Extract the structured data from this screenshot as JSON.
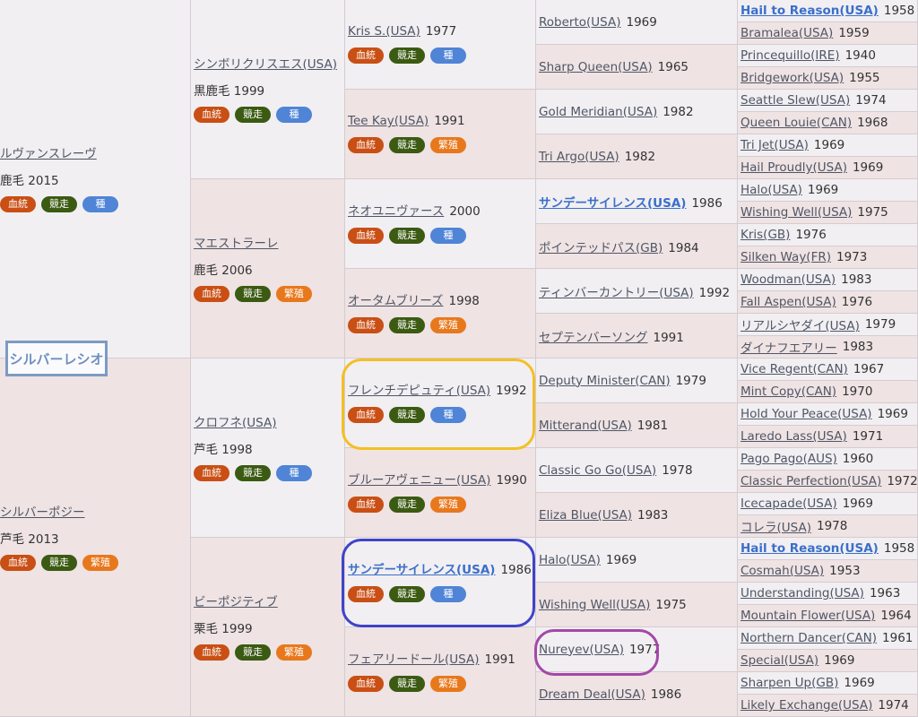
{
  "badges": {
    "red": "血統",
    "green": "競走",
    "blue": "種",
    "orange": "繁殖"
  },
  "subject": "シルバーレシオ",
  "gen1": [
    {
      "name": "ルヴァンスレーヴ",
      "coat": "鹿毛 2015",
      "tags": [
        "red",
        "green",
        "blue"
      ]
    },
    {
      "name": "シルバーポジー",
      "coat": "芦毛 2013",
      "tags": [
        "red",
        "green",
        "orange"
      ]
    }
  ],
  "gen2": [
    {
      "name": "シンボリクリスエス(USA)",
      "coat": "黒鹿毛 1999",
      "tags": [
        "red",
        "green",
        "blue"
      ]
    },
    {
      "name": "マエストラーレ",
      "coat": "鹿毛 2006",
      "tags": [
        "red",
        "green",
        "orange"
      ]
    },
    {
      "name": "クロフネ(USA)",
      "coat": "芦毛 1998",
      "tags": [
        "red",
        "green",
        "blue"
      ]
    },
    {
      "name": "ビーポジティブ",
      "coat": "栗毛 1999",
      "tags": [
        "red",
        "green",
        "orange"
      ]
    }
  ],
  "gen3": [
    {
      "name": "Kris S.(USA)",
      "year": "1977",
      "tags": [
        "red",
        "green",
        "blue"
      ]
    },
    {
      "name": "Tee Kay(USA)",
      "year": "1991",
      "tags": [
        "red",
        "green",
        "orange"
      ]
    },
    {
      "name": "ネオユニヴァース",
      "year": "2000",
      "tags": [
        "red",
        "green",
        "blue"
      ]
    },
    {
      "name": "オータムブリーズ",
      "year": "1998",
      "tags": [
        "red",
        "green",
        "orange"
      ]
    },
    {
      "name": "フレンチデピュティ(USA)",
      "year": "1992",
      "tags": [
        "red",
        "green",
        "blue"
      ]
    },
    {
      "name": "ブルーアヴェニュー(USA)",
      "year": "1990",
      "tags": [
        "red",
        "green",
        "orange"
      ]
    },
    {
      "name": "サンデーサイレンス(USA)",
      "year": "1986",
      "tags": [
        "red",
        "green",
        "blue"
      ],
      "bold": true
    },
    {
      "name": "フェアリードール(USA)",
      "year": "1991",
      "tags": [
        "red",
        "green",
        "orange"
      ]
    }
  ],
  "gen4": [
    {
      "name": "Roberto(USA)",
      "year": "1969"
    },
    {
      "name": "Sharp Queen(USA)",
      "year": "1965"
    },
    {
      "name": "Gold Meridian(USA)",
      "year": "1982"
    },
    {
      "name": "Tri Argo(USA)",
      "year": "1982"
    },
    {
      "name": "サンデーサイレンス(USA)",
      "year": "1986",
      "bold": true
    },
    {
      "name": "ポインテッドパス(GB)",
      "year": "1984"
    },
    {
      "name": "ティンバーカントリー(USA)",
      "year": "1992"
    },
    {
      "name": "セプテンバーソング",
      "year": "1991"
    },
    {
      "name": "Deputy Minister(CAN)",
      "year": "1979"
    },
    {
      "name": "Mitterand(USA)",
      "year": "1981"
    },
    {
      "name": "Classic Go Go(USA)",
      "year": "1978"
    },
    {
      "name": "Eliza Blue(USA)",
      "year": "1983"
    },
    {
      "name": "Halo(USA)",
      "year": "1969"
    },
    {
      "name": "Wishing Well(USA)",
      "year": "1975"
    },
    {
      "name": "Nureyev(USA)",
      "year": "1977"
    },
    {
      "name": "Dream Deal(USA)",
      "year": "1986"
    }
  ],
  "gen5": [
    {
      "name": "Hail to Reason(USA)",
      "year": "1958",
      "bold": true
    },
    {
      "name": "Bramalea(USA)",
      "year": "1959"
    },
    {
      "name": "Princequillo(IRE)",
      "year": "1940"
    },
    {
      "name": "Bridgework(USA)",
      "year": "1955"
    },
    {
      "name": "Seattle Slew(USA)",
      "year": "1974"
    },
    {
      "name": "Queen Louie(CAN)",
      "year": "1968"
    },
    {
      "name": "Tri Jet(USA)",
      "year": "1969"
    },
    {
      "name": "Hail Proudly(USA)",
      "year": "1969"
    },
    {
      "name": "Halo(USA)",
      "year": "1969"
    },
    {
      "name": "Wishing Well(USA)",
      "year": "1975"
    },
    {
      "name": "Kris(GB)",
      "year": "1976"
    },
    {
      "name": "Silken Way(FR)",
      "year": "1973"
    },
    {
      "name": "Woodman(USA)",
      "year": "1983"
    },
    {
      "name": "Fall Aspen(USA)",
      "year": "1976"
    },
    {
      "name": "リアルシヤダイ(USA)",
      "year": "1979"
    },
    {
      "name": "ダイナフエアリー",
      "year": "1983"
    },
    {
      "name": "Vice Regent(CAN)",
      "year": "1967"
    },
    {
      "name": "Mint Copy(CAN)",
      "year": "1970"
    },
    {
      "name": "Hold Your Peace(USA)",
      "year": "1969"
    },
    {
      "name": "Laredo Lass(USA)",
      "year": "1971"
    },
    {
      "name": "Pago Pago(AUS)",
      "year": "1960"
    },
    {
      "name": "Classic Perfection(USA)",
      "year": "1972"
    },
    {
      "name": "Icecapade(USA)",
      "year": "1969"
    },
    {
      "name": "コレラ(USA)",
      "year": "1978"
    },
    {
      "name": "Hail to Reason(USA)",
      "year": "1958",
      "bold": true
    },
    {
      "name": "Cosmah(USA)",
      "year": "1953"
    },
    {
      "name": "Understanding(USA)",
      "year": "1963"
    },
    {
      "name": "Mountain Flower(USA)",
      "year": "1964"
    },
    {
      "name": "Northern Dancer(CAN)",
      "year": "1961"
    },
    {
      "name": "Special(USA)",
      "year": "1969"
    },
    {
      "name": "Sharpen Up(GB)",
      "year": "1969"
    },
    {
      "name": "Likely Exchange(USA)",
      "year": "1974"
    }
  ],
  "highlight_colors": {
    "gen3_4": "#f4bf24",
    "gen3_6": "#3f44c8",
    "gen4_14": "#a348a8"
  }
}
